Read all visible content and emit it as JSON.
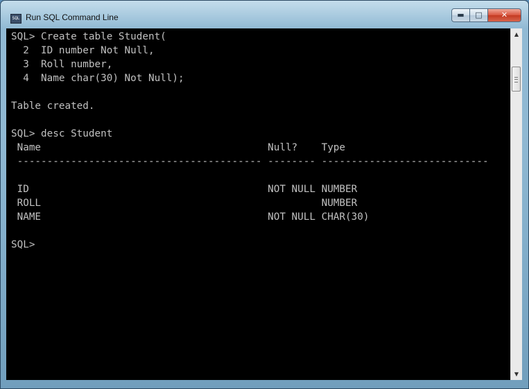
{
  "window": {
    "title": "Run SQL Command Line",
    "icon": "sql-app-icon",
    "icon_text": "SQL",
    "controls": {
      "minimize": "minimize-icon",
      "maximize": "maximize-icon",
      "close": "close-icon"
    }
  },
  "console": {
    "lines": [
      "SQL> Create table Student(",
      "  2  ID number Not Null,",
      "  3  Roll number,",
      "  4  Name char(30) Not Null);",
      "",
      "Table created.",
      "",
      "SQL> desc Student",
      " Name                                      Null?    Type",
      " ----------------------------------------- -------- ----------------------------",
      "",
      " ID                                        NOT NULL NUMBER",
      " ROLL                                               NUMBER",
      " NAME                                      NOT NULL CHAR(30)",
      "",
      "SQL>"
    ]
  },
  "colors": {
    "console_bg": "#000000",
    "console_fg": "#c0c0c0",
    "close_button": "#c43a22"
  }
}
